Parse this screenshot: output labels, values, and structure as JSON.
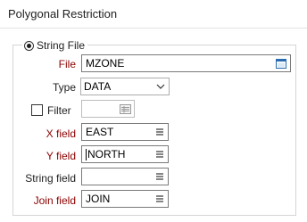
{
  "panel": {
    "title": "Polygonal Restriction"
  },
  "string_file_option": {
    "label": "String File",
    "selected": true
  },
  "fields": {
    "file": {
      "label": "File",
      "value": "MZONE",
      "icon": "file-browse-icon"
    },
    "type": {
      "label": "Type",
      "value": "DATA",
      "icon": "chevron-down-icon"
    },
    "filter": {
      "label": "Filter",
      "checked": false,
      "value": "",
      "icon": "filter-list-icon"
    },
    "x_field": {
      "label": "X field",
      "value": "EAST",
      "icon": "field-list-icon"
    },
    "y_field": {
      "label": "Y field",
      "value": "NORTH",
      "icon": "field-list-icon"
    },
    "string_field": {
      "label": "String field",
      "value": "",
      "icon": "field-list-icon"
    },
    "join_field": {
      "label": "Join field",
      "value": "JOIN",
      "icon": "field-list-icon"
    }
  },
  "colors": {
    "required_label": "#8b0000",
    "file_icon": "#2b6cb0"
  }
}
